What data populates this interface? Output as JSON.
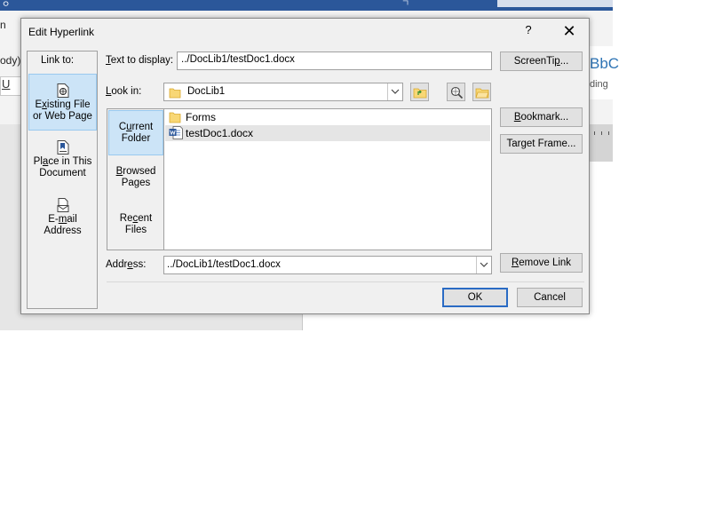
{
  "background": {
    "left_fragment_1": "n",
    "left_fragment_2": "ody)",
    "left_underline_button": "U",
    "style_preview": "BbC",
    "style_preview_sub": "ding"
  },
  "dialog": {
    "title": "Edit Hyperlink",
    "help_label": "?",
    "close_label": "✕",
    "link_to_label": "Link to:",
    "link_to_items": [
      {
        "line1_pre": "E",
        "line1_u": "x",
        "line1_post": "isting File",
        "line2": "or Web Page",
        "selected": true
      },
      {
        "line1_pre": "Pl",
        "line1_u": "a",
        "line1_post": "ce in This",
        "line2": "Document",
        "selected": false
      },
      {
        "line1_pre": "E-",
        "line1_u": "m",
        "line1_post": "ail",
        "line2": "Address",
        "selected": false
      }
    ],
    "text_to_display": {
      "label_u": "T",
      "label_rest": "ext to display:",
      "value": "../DocLib1/testDoc1.docx"
    },
    "screentip_button": {
      "pre": "ScreenTi",
      "u": "p",
      "post": "..."
    },
    "look_in": {
      "label_u": "L",
      "label_rest": "ook in:",
      "value": "DocLib1"
    },
    "browse_tabs": [
      {
        "line1_pre": "C",
        "line1_u": "u",
        "line1_post": "rrent",
        "line2": "Folder",
        "selected": true
      },
      {
        "line1_pre": "",
        "line1_u": "B",
        "line1_post": "rowsed",
        "line2": "Pages",
        "selected": false
      },
      {
        "line1_pre": "Re",
        "line1_u": "c",
        "line1_post": "ent",
        "line2": "Files",
        "selected": false
      }
    ],
    "files": [
      {
        "name": "Forms",
        "icon": "folder-icon"
      },
      {
        "name": "testDoc1.docx",
        "icon": "word-doc-icon"
      }
    ],
    "bookmark_button": {
      "pre": "",
      "u": "B",
      "post": "ookmark..."
    },
    "target_frame_button": {
      "pre": "Tar",
      "u": "g",
      "post": "et Frame..."
    },
    "address": {
      "label_pre": "Addr",
      "label_u": "e",
      "label_post": "ss:",
      "value": "../DocLib1/testDoc1.docx"
    },
    "remove_link_button": {
      "pre": "",
      "u": "R",
      "post": "emove Link"
    },
    "ok_button": "OK",
    "cancel_button": "Cancel"
  },
  "colors": {
    "accent": "#2b579a",
    "selection": "#cce4f7",
    "default_button_border": "#2a6bc4"
  }
}
